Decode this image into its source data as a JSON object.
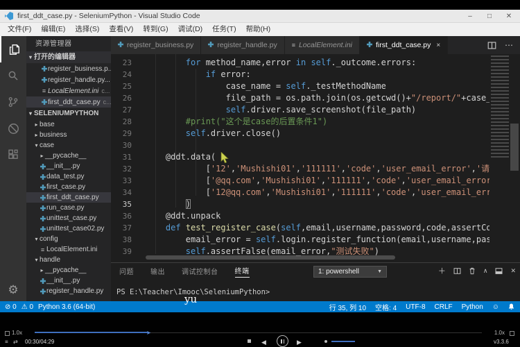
{
  "window": {
    "title": "first_ddt_case.py - SeleniumPython - Visual Studio Code",
    "controls": {
      "minimize": "–",
      "restore": "□",
      "close": "✕"
    },
    "menus": [
      "文件(F)",
      "编辑(E)",
      "选择(S)",
      "查看(V)",
      "转到(G)",
      "调试(D)",
      "任务(T)",
      "帮助(H)"
    ]
  },
  "sidebar": {
    "title": "资源管理器",
    "open_editors_label": "打开的编辑器",
    "open_editors": [
      {
        "label": "register_business.p...",
        "icon": "py"
      },
      {
        "label": "register_handle.py...",
        "icon": "py"
      },
      {
        "label": "LocalElement.ini",
        "suffix": "c...",
        "icon": "ini",
        "italic": true
      },
      {
        "label": "first_ddt_case.py",
        "suffix": "c...",
        "icon": "py",
        "selected": true
      }
    ],
    "project": "SELENIUMPYTHON",
    "tree": [
      {
        "label": "base",
        "type": "folder",
        "expanded": false,
        "indent": 0
      },
      {
        "label": "business",
        "type": "folder",
        "expanded": false,
        "indent": 0
      },
      {
        "label": "case",
        "type": "folder",
        "expanded": true,
        "indent": 0
      },
      {
        "label": "__pycache__",
        "type": "folder",
        "expanded": false,
        "indent": 1
      },
      {
        "label": "__init__.py",
        "type": "py",
        "indent": 1
      },
      {
        "label": "data_test.py",
        "type": "py",
        "indent": 1
      },
      {
        "label": "first_case.py",
        "type": "py",
        "indent": 1
      },
      {
        "label": "first_ddt_case.py",
        "type": "py",
        "indent": 1,
        "selected": true
      },
      {
        "label": "run_case.py",
        "type": "py",
        "indent": 1
      },
      {
        "label": "unittest_case.py",
        "type": "py",
        "indent": 1
      },
      {
        "label": "unittest_case02.py",
        "type": "py",
        "indent": 1
      },
      {
        "label": "config",
        "type": "folder",
        "expanded": true,
        "indent": 0
      },
      {
        "label": "LocalElement.ini",
        "type": "ini",
        "indent": 1
      },
      {
        "label": "handle",
        "type": "folder",
        "expanded": true,
        "indent": 0
      },
      {
        "label": "__pycache__",
        "type": "folder",
        "expanded": false,
        "indent": 1
      },
      {
        "label": "__init__.py",
        "type": "py",
        "indent": 1
      },
      {
        "label": "register_handle.py",
        "type": "py",
        "indent": 1
      }
    ]
  },
  "tabs": [
    {
      "label": "register_business.py",
      "icon": "py"
    },
    {
      "label": "register_handle.py",
      "icon": "py"
    },
    {
      "label": "LocalElement.ini",
      "icon": "ini",
      "italic": true
    },
    {
      "label": "first_ddt_case.py",
      "icon": "py",
      "active": true,
      "close": "×"
    }
  ],
  "tab_actions": {
    "more": "⋯"
  },
  "editor": {
    "lines": [
      {
        "n": "23",
        "segs": [
          {
            "s": "        ",
            "c": "p"
          },
          {
            "s": "for",
            "c": "k"
          },
          {
            "s": " method_name,error ",
            "c": "p"
          },
          {
            "s": "in",
            "c": "k"
          },
          {
            "s": " ",
            "c": "p"
          },
          {
            "s": "self",
            "c": "k"
          },
          {
            "s": "._outcome.errors:",
            "c": "p"
          }
        ]
      },
      {
        "n": "24",
        "segs": [
          {
            "s": "            ",
            "c": "p"
          },
          {
            "s": "if",
            "c": "k"
          },
          {
            "s": " error:",
            "c": "p"
          }
        ]
      },
      {
        "n": "25",
        "segs": [
          {
            "s": "                case_name = ",
            "c": "p"
          },
          {
            "s": "self",
            "c": "k"
          },
          {
            "s": "._testMethodName",
            "c": "p"
          }
        ]
      },
      {
        "n": "26",
        "segs": [
          {
            "s": "                file_path = os.path.join(os.getcwd()+",
            "c": "p"
          },
          {
            "s": "\"/report/\"",
            "c": "s"
          },
          {
            "s": "+case_n",
            "c": "p"
          }
        ]
      },
      {
        "n": "27",
        "segs": [
          {
            "s": "                ",
            "c": "p"
          },
          {
            "s": "self",
            "c": "k"
          },
          {
            "s": ".driver.save_screenshot(file_path)",
            "c": "p"
          }
        ]
      },
      {
        "n": "28",
        "segs": [
          {
            "s": "        ",
            "c": "p"
          },
          {
            "s": "#print(\"这个是case的后置条件1\")",
            "c": "c"
          }
        ]
      },
      {
        "n": "29",
        "segs": [
          {
            "s": "        ",
            "c": "p"
          },
          {
            "s": "self",
            "c": "k"
          },
          {
            "s": ".driver.close()",
            "c": "p"
          }
        ]
      },
      {
        "n": "30",
        "segs": []
      },
      {
        "n": "31",
        "segs": [
          {
            "s": "    @ddt.data(",
            "c": "p"
          }
        ]
      },
      {
        "n": "32",
        "segs": [
          {
            "s": "            [",
            "c": "p"
          },
          {
            "s": "'12'",
            "c": "s"
          },
          {
            "s": ",",
            "c": "p"
          },
          {
            "s": "'Mushishi01'",
            "c": "s"
          },
          {
            "s": ",",
            "c": "p"
          },
          {
            "s": "'111111'",
            "c": "s"
          },
          {
            "s": ",",
            "c": "p"
          },
          {
            "s": "'code'",
            "c": "s"
          },
          {
            "s": ",",
            "c": "p"
          },
          {
            "s": "'user_email_error'",
            "c": "s"
          },
          {
            "s": ",",
            "c": "p"
          },
          {
            "s": "'请输入",
            "c": "s"
          }
        ]
      },
      {
        "n": "33",
        "segs": [
          {
            "s": "            [",
            "c": "p"
          },
          {
            "s": "'@qq.com'",
            "c": "s"
          },
          {
            "s": ",",
            "c": "p"
          },
          {
            "s": "'Mushishi01'",
            "c": "s"
          },
          {
            "s": ",",
            "c": "p"
          },
          {
            "s": "'111111'",
            "c": "s"
          },
          {
            "s": ",",
            "c": "p"
          },
          {
            "s": "'code'",
            "c": "s"
          },
          {
            "s": ",",
            "c": "p"
          },
          {
            "s": "'user_email_error'",
            "c": "s"
          },
          {
            "s": ",",
            "c": "p"
          },
          {
            "s": "'",
            "c": "s"
          }
        ]
      },
      {
        "n": "34",
        "segs": [
          {
            "s": "            [",
            "c": "p"
          },
          {
            "s": "'12@qq.com'",
            "c": "s"
          },
          {
            "s": ",",
            "c": "p"
          },
          {
            "s": "'Mushishi01'",
            "c": "s"
          },
          {
            "s": ",",
            "c": "p"
          },
          {
            "s": "'111111'",
            "c": "s"
          },
          {
            "s": ",",
            "c": "p"
          },
          {
            "s": "'code'",
            "c": "s"
          },
          {
            "s": ",",
            "c": "p"
          },
          {
            "s": "'user_email_error'",
            "c": "s"
          }
        ]
      },
      {
        "n": "35",
        "active": true,
        "segs": [
          {
            "s": "        ",
            "c": "p"
          },
          {
            "s": ")",
            "c": "p",
            "b": true
          }
        ]
      },
      {
        "n": "36",
        "segs": [
          {
            "s": "    @ddt.unpack",
            "c": "p"
          }
        ]
      },
      {
        "n": "37",
        "segs": [
          {
            "s": "    ",
            "c": "p"
          },
          {
            "s": "def",
            "c": "k"
          },
          {
            "s": " ",
            "c": "p"
          },
          {
            "s": "test_register_case",
            "c": "f"
          },
          {
            "s": "(",
            "c": "p"
          },
          {
            "s": "self",
            "c": "k"
          },
          {
            "s": ",email,username,password,code,assertCode,",
            "c": "p"
          }
        ]
      },
      {
        "n": "38",
        "segs": [
          {
            "s": "        email_error = ",
            "c": "p"
          },
          {
            "s": "self",
            "c": "k"
          },
          {
            "s": ".login.register_function(email,username,passwo",
            "c": "p"
          }
        ]
      },
      {
        "n": "39",
        "segs": [
          {
            "s": "        ",
            "c": "p"
          },
          {
            "s": "self",
            "c": "k"
          },
          {
            "s": ".assertFalse(email_error,",
            "c": "p"
          },
          {
            "s": "\"测试失败\"",
            "c": "s"
          },
          {
            "s": ")",
            "c": "p"
          }
        ]
      }
    ]
  },
  "panel": {
    "tabs": [
      {
        "label": "问题"
      },
      {
        "label": "输出"
      },
      {
        "label": "调试控制台"
      },
      {
        "label": "终端",
        "active": true
      }
    ],
    "shell_select": "1: powershell",
    "actions": {
      "add": "＋",
      "collapse": "∧",
      "close": "✕"
    },
    "terminal_prompt": "PS E:\\Teacher\\Imooc\\SeleniumPython>"
  },
  "status_bar": {
    "error_count": "0",
    "warning_count": "0",
    "python_version": "Python 3.6 (64-bit)",
    "line_col": "行 35, 列 10",
    "spaces": "空格: 4",
    "encoding": "UTF-8",
    "eol": "CRLF",
    "language": "Python"
  },
  "video_player": {
    "watermark": "yu",
    "speed_left": "1.0x",
    "speed_right": "1.0x",
    "time": "00:30/04:29",
    "version": "v3.3.6"
  },
  "colors": {
    "statusbar": "#007acc",
    "editor_bg": "#1e1e1e",
    "sidebar_bg": "#252526",
    "activitybar_bg": "#333333",
    "keyword": "#569cd6",
    "string": "#ce9178",
    "comment": "#6a9955",
    "python_icon": "#519aba"
  }
}
